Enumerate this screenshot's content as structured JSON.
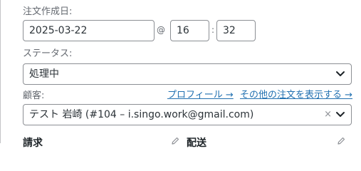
{
  "order_date": {
    "label": "注文作成日:",
    "date_value": "2025-03-22",
    "at_separator": "@",
    "hour_value": "16",
    "time_separator": ":",
    "minute_value": "32"
  },
  "status": {
    "label": "ステータス:",
    "selected": "処理中"
  },
  "customer": {
    "label": "顧客:",
    "profile_link": "プロフィール →",
    "other_orders_link": "その他の注文を表示する →",
    "selected": "テスト 岩崎 (#104 – i.singo.work@gmail.com)",
    "clear_symbol": "×"
  },
  "billing": {
    "heading": "請求"
  },
  "shipping": {
    "heading": "配送"
  },
  "icons": {
    "select_arrow": "chevron-down-icon",
    "edit": "pencil-icon"
  },
  "colors": {
    "link": "#2271b1",
    "border": "#8c8f94",
    "label": "#646970"
  }
}
